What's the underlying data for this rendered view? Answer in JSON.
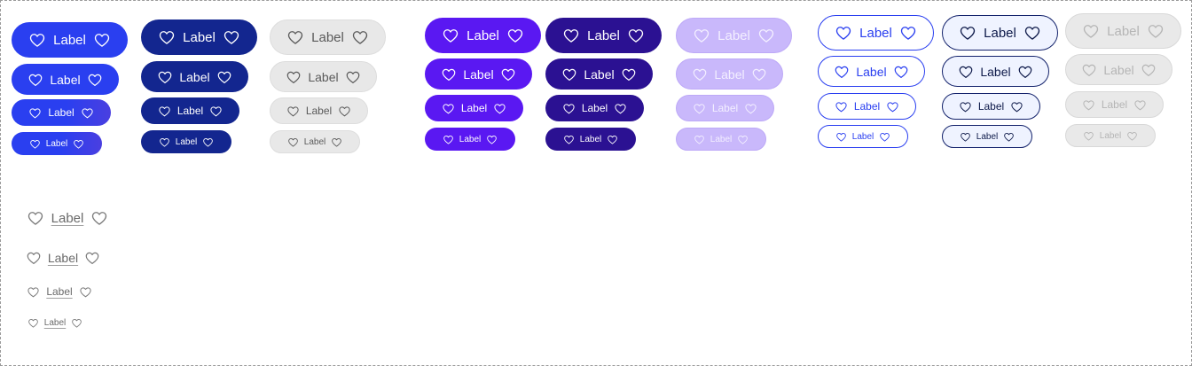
{
  "button_label": "Label",
  "groups": [
    {
      "name": "primary-blue",
      "variant": "blue"
    },
    {
      "name": "primary-navy",
      "variant": "navy"
    },
    {
      "name": "primary-disabled",
      "variant": "grey"
    },
    {
      "name": "secondary-violet",
      "variant": "violet"
    },
    {
      "name": "secondary-grape",
      "variant": "grape"
    },
    {
      "name": "secondary-disabled",
      "variant": "lilac"
    },
    {
      "name": "outline-blue",
      "variant": "outline"
    },
    {
      "name": "outline-dark",
      "variant": "outdark"
    },
    {
      "name": "outline-disabled",
      "variant": "outgrey"
    },
    {
      "name": "link",
      "variant": "link"
    }
  ],
  "sizes": [
    "large",
    "medium",
    "small",
    "extra-small"
  ],
  "icon": "heart-icon",
  "colors": {
    "blue": "#2a3ff0",
    "navy": "#13268f",
    "grey": "#e8e8e8",
    "violet": "#5a18f2",
    "grape": "#2b1192",
    "lilac": "#c9b8fb",
    "outline_border": "#2a3ff0",
    "outline_dark_border": "#13226b",
    "link_text": "#6a6a6a"
  }
}
